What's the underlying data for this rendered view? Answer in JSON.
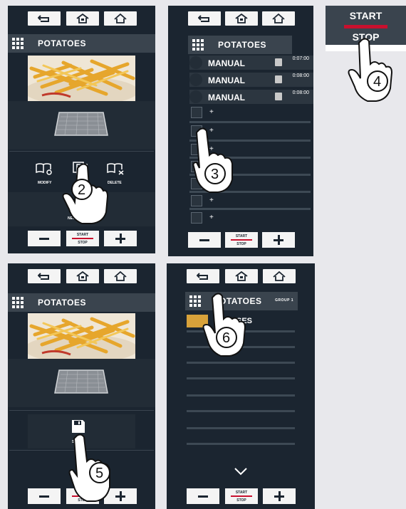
{
  "common": {
    "start_label": "START",
    "stop_label": "STOP"
  },
  "screens": [
    {
      "title": "POTATOES",
      "icons": [
        "book-eye-icon",
        "copy-icon",
        "book-delete-icon"
      ],
      "icon_labels": [
        "MODIFY",
        "",
        "DELETE"
      ],
      "new_label": "NEW NE",
      "step": "2"
    },
    {
      "title": "POTATOES",
      "programs": [
        {
          "name": "MANUAL",
          "time": "0:07:00"
        },
        {
          "name": "MANUAL",
          "time": "0:08:00"
        },
        {
          "name": "MANUAL",
          "time": "0:08:00"
        }
      ],
      "empty_steps": [
        "+",
        "+",
        "+",
        "+",
        "+",
        "+",
        "+"
      ],
      "step": "3"
    },
    {
      "title": "POTATOES",
      "save_label": "SA",
      "step": "5"
    },
    {
      "title": "OTATOES",
      "group": "GROUP 1",
      "list_item": "SES",
      "step": "6"
    }
  ],
  "big_button": {
    "start": "START",
    "stop": "STOP",
    "step": "4"
  },
  "colors": {
    "panel_bg": "#1b2530",
    "accent_red": "#c8102e",
    "button_bg": "#f4f4f4"
  }
}
